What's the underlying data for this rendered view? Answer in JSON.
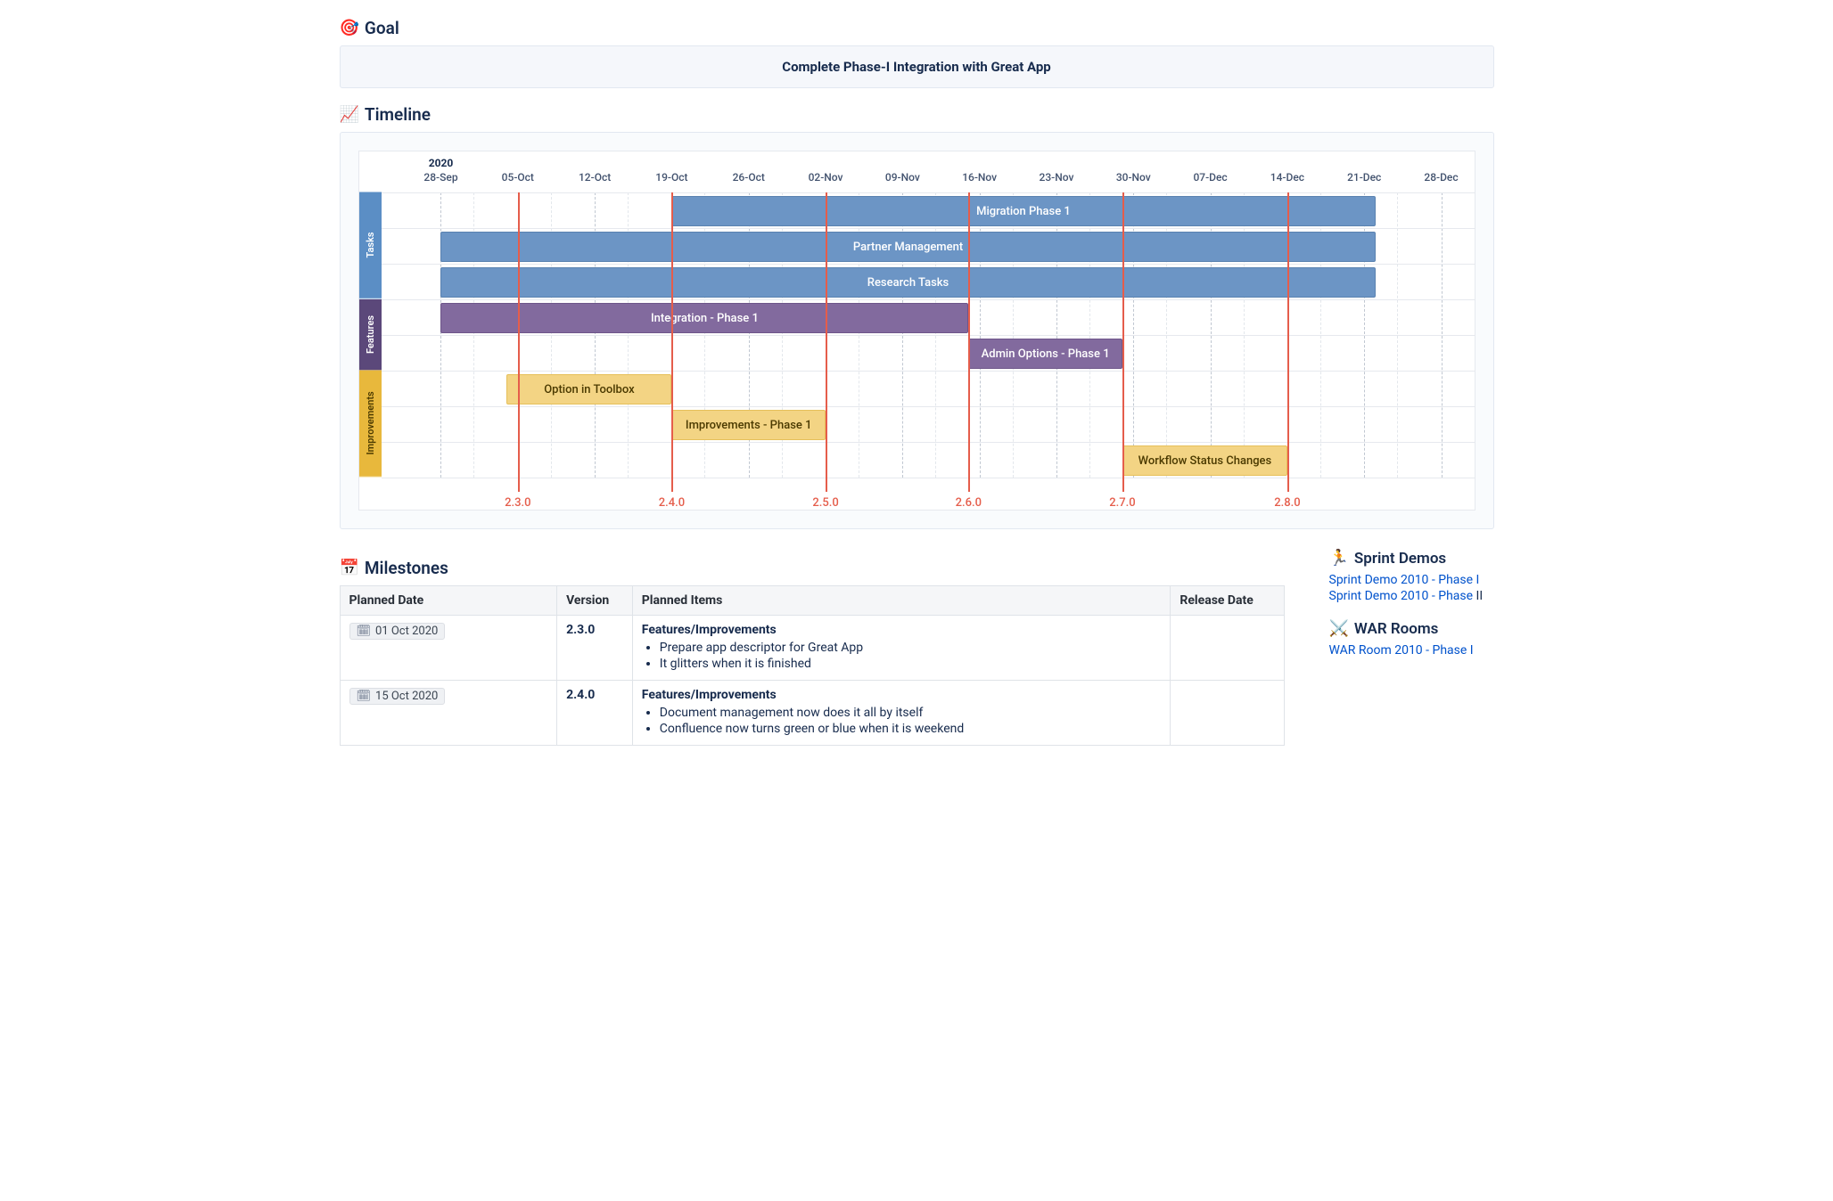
{
  "goal": {
    "title": "Goal",
    "icon": "🎯",
    "text": "Complete Phase-I Integration with Great App"
  },
  "timeline": {
    "title": "Timeline",
    "icon": "📈"
  },
  "chart_data": {
    "type": "gantt",
    "x_unit": "date",
    "year_label": "2020",
    "x_domain": [
      "2020-09-25",
      "2020-12-31"
    ],
    "ticks": [
      {
        "date": "2020-09-28",
        "label": "28-Sep"
      },
      {
        "date": "2020-10-05",
        "label": "05-Oct"
      },
      {
        "date": "2020-10-12",
        "label": "12-Oct"
      },
      {
        "date": "2020-10-19",
        "label": "19-Oct"
      },
      {
        "date": "2020-10-26",
        "label": "26-Oct"
      },
      {
        "date": "2020-11-02",
        "label": "02-Nov"
      },
      {
        "date": "2020-11-09",
        "label": "09-Nov"
      },
      {
        "date": "2020-11-16",
        "label": "16-Nov"
      },
      {
        "date": "2020-11-23",
        "label": "23-Nov"
      },
      {
        "date": "2020-11-30",
        "label": "30-Nov"
      },
      {
        "date": "2020-12-07",
        "label": "07-Dec"
      },
      {
        "date": "2020-12-14",
        "label": "14-Dec"
      },
      {
        "date": "2020-12-21",
        "label": "21-Dec"
      },
      {
        "date": "2020-12-28",
        "label": "28-Dec"
      }
    ],
    "swimlanes": [
      "Tasks",
      "Features",
      "Improvements"
    ],
    "rows": [
      {
        "lane": "Tasks",
        "bars": [
          {
            "name": "Migration Phase 1",
            "start": "2020-10-19",
            "end": "2020-12-22"
          }
        ]
      },
      {
        "lane": "Tasks",
        "bars": [
          {
            "name": "Partner Management",
            "start": "2020-09-28",
            "end": "2020-12-22"
          }
        ]
      },
      {
        "lane": "Tasks",
        "bars": [
          {
            "name": "Research Tasks",
            "start": "2020-09-28",
            "end": "2020-12-22"
          }
        ]
      },
      {
        "lane": "Features",
        "bars": [
          {
            "name": "Integration - Phase 1",
            "start": "2020-09-28",
            "end": "2020-11-15"
          }
        ]
      },
      {
        "lane": "Features",
        "bars": [
          {
            "name": "Admin Options - Phase 1",
            "start": "2020-11-15",
            "end": "2020-11-29"
          }
        ]
      },
      {
        "lane": "Improvements",
        "bars": [
          {
            "name": "Option in Toolbox",
            "start": "2020-10-04",
            "end": "2020-10-19"
          }
        ]
      },
      {
        "lane": "Improvements",
        "bars": [
          {
            "name": "Improvements - Phase 1",
            "start": "2020-10-19",
            "end": "2020-11-02"
          }
        ]
      },
      {
        "lane": "Improvements",
        "bars": [
          {
            "name": "Workflow Status Changes",
            "start": "2020-11-29",
            "end": "2020-12-14"
          }
        ]
      }
    ],
    "milestone_lines": [
      {
        "date": "2020-10-05",
        "label": "2.3.0"
      },
      {
        "date": "2020-10-19",
        "label": "2.4.0"
      },
      {
        "date": "2020-11-02",
        "label": "2.5.0"
      },
      {
        "date": "2020-11-15",
        "label": "2.6.0"
      },
      {
        "date": "2020-11-29",
        "label": "2.7.0"
      },
      {
        "date": "2020-12-14",
        "label": "2.8.0"
      }
    ],
    "lane_colors": {
      "Tasks": "#6c95c5",
      "Features": "#826a9e",
      "Improvements": "#f3d484"
    }
  },
  "milestones": {
    "title": "Milestones",
    "icon": "📅",
    "columns": [
      "Planned Date",
      "Version",
      "Planned Items",
      "Release Date"
    ],
    "rows": [
      {
        "date": "01 Oct 2020",
        "version": "2.3.0",
        "group_label": "Features/Improvements",
        "items": [
          "Prepare app descriptor for Great App",
          "It glitters when it is finished"
        ],
        "release": ""
      },
      {
        "date": "15 Oct 2020",
        "version": "2.4.0",
        "group_label": "Features/Improvements",
        "items": [
          "Document management now does it all by itself",
          "Confluence now turns green or blue when it is weekend"
        ],
        "release": ""
      }
    ]
  },
  "sprint_demos": {
    "title": "Sprint Demos",
    "icon": "🏃",
    "links": [
      {
        "text": "Sprint Demo 2010 - Phase I",
        "suffix": ""
      },
      {
        "text": "Sprint Demo 2010 - Phase ",
        "suffix": "II"
      }
    ]
  },
  "war_rooms": {
    "title": "WAR Rooms",
    "icon": "⚔️",
    "links": [
      {
        "text": "WAR Room 2010 - Phase I",
        "suffix": ""
      }
    ]
  }
}
